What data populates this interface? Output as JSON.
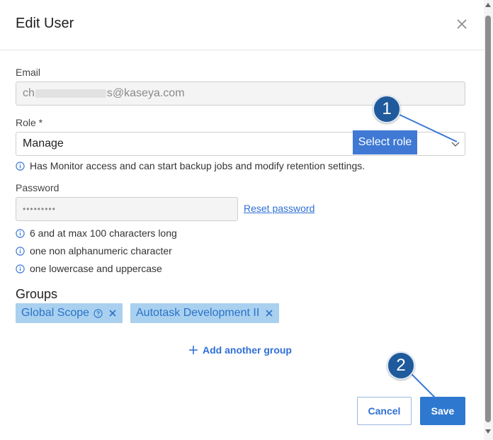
{
  "dialog": {
    "title": "Edit User"
  },
  "email": {
    "label": "Email",
    "value_start": "ch",
    "value_end": "s@kaseya.com"
  },
  "role": {
    "label": "Role *",
    "selected": "Manage",
    "hint": "Has Monitor access and can start backup jobs and modify retention settings."
  },
  "password": {
    "label": "Password",
    "value": "•••••••••",
    "reset_link": "Reset password",
    "rules": [
      "6 and at max 100 characters long",
      "one non alphanumeric character",
      "one lowercase and uppercase"
    ]
  },
  "groups": {
    "heading": "Groups",
    "chips": [
      {
        "label": "Global Scope",
        "has_help": true
      },
      {
        "label": "Autotask Development II",
        "has_help": false
      }
    ],
    "add_label": "Add another group"
  },
  "actions": {
    "cancel_label": "Cancel",
    "save_label": "Save"
  },
  "annotations": {
    "tooltip": "Select role",
    "callout_1": "1",
    "callout_2": "2"
  },
  "colors": {
    "accent": "#2f78cf",
    "chip_bg": "#a9d0ef",
    "callout": "#1f5a9c",
    "tooltip_bg": "#3f79d4"
  },
  "icons": {
    "close": "close-icon",
    "chevron": "chevron-down-icon",
    "info": "info-icon",
    "help": "help-icon",
    "remove": "remove-chip-icon",
    "plus": "plus-icon"
  }
}
